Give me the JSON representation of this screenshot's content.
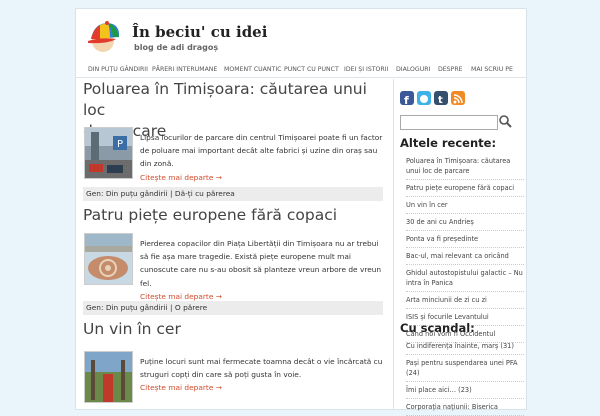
{
  "site": {
    "title": "În beciu' cu idei",
    "tagline": "blog de adi dragoș"
  },
  "nav": [
    "DIN PUȚU GÂNDIRII",
    "PĂRERI INTERUMANE",
    "MOMENT CUANTIC",
    "PUNCT CU PUNCT",
    "IDEI ȘI ISTORII",
    "DIALOGURI",
    "DESPRE",
    "MAI SCRIU PE"
  ],
  "posts": [
    {
      "title_line1": "Poluarea în Timișoara: căutarea unui loc",
      "title_line2": "de parcare",
      "excerpt": "Lipsa locurilor de parcare din centrul Timișoarei poate fi un factor de poluare mai important decât alte fabrici și uzine din oraș sau din zonă.",
      "more": "Citește mai departe →",
      "gen_label": "Gen:",
      "categories": [
        "Din puțu gândirii",
        "Dă-ți cu părerea"
      ]
    },
    {
      "title_line1": "Patru piețe europene fără copaci",
      "excerpt": "Pierderea copacilor din Piața Libertății din Timișoara nu ar trebui să fie așa mare tragedie. Există piețe europene mult mai cunoscute care nu s-au obosit să planteze vreun arbore de vreun fel.",
      "more": "Citește mai departe →",
      "gen_label": "Gen:",
      "categories": [
        "Din puțu gândirii",
        "O părere"
      ]
    },
    {
      "title_line1": "Un vin în cer",
      "excerpt": "Puține locuri sunt mai fermecate toamna decât o vie încărcată cu struguri copți din care să poți gusta în voie.",
      "more": "Citește mai departe →"
    }
  ],
  "sidebar": {
    "social_icons": [
      "facebook-icon",
      "twitter-icon",
      "tumblr-icon",
      "rss-icon"
    ],
    "search_placeholder": "",
    "recent_heading": "Altele recente:",
    "recent": [
      "Poluarea în Timișoara: căutarea unui loc de parcare",
      "Patru piețe europene fără copaci",
      "Un vin în cer",
      "30 de ani cu Andrieș",
      "Ponta va fi președinte",
      "Bac-ul, mai relevant ca oricând",
      "Ghidul autostopistului galactic – Nu intra în Panica",
      "Arta minciunii de zi cu zi",
      "ISIS și focurile Levantului",
      "Când noi vom fi Occidentul"
    ],
    "scandal_heading": "Cu scandal:",
    "scandal": [
      "Cu indiferența înainte, marș (31)",
      "Pași pentru suspendarea unei PFA (24)",
      "Îmi place aici… (23)",
      "Corporația națiunii: Biserica"
    ]
  },
  "colors": {
    "background": "#eaf4fb",
    "link_accent": "#d04a2a",
    "category_bar": "#ececec"
  }
}
